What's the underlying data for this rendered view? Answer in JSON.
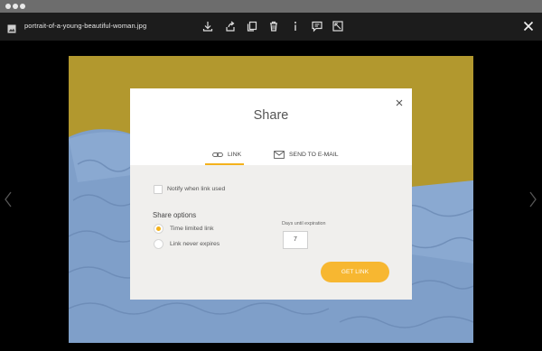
{
  "viewer": {
    "filename": "portrait-of-a-young-beautiful-woman.jpg",
    "toolbar_icons": [
      "download-icon",
      "share-icon",
      "copy-icon",
      "trash-icon",
      "info-icon",
      "comment-icon",
      "fullscreen-icon"
    ],
    "close_icon": "close-icon",
    "nav": [
      "chevron-left-icon",
      "chevron-right-icon"
    ]
  },
  "share_dialog": {
    "title": "Share",
    "tabs": [
      {
        "label": "LINK",
        "icon": "link-icon",
        "active": true
      },
      {
        "label": "SEND TO E-MAIL",
        "icon": "mail-icon",
        "active": false
      }
    ],
    "notify_label": "Notify when link used",
    "notify_checked": false,
    "share_options_label": "Share options",
    "options": [
      {
        "label": "Time limited link",
        "selected": true
      },
      {
        "label": "Link never expires",
        "selected": false
      }
    ],
    "expiration_label": "Days until expiration",
    "expiration_value": "7",
    "get_link_label": "GET LINK"
  },
  "colors": {
    "accent": "#f4b21c",
    "toolbar_bg": "#1c1c1c",
    "photo_bg": "#b2982e",
    "sweater": "#7f9fc9"
  }
}
